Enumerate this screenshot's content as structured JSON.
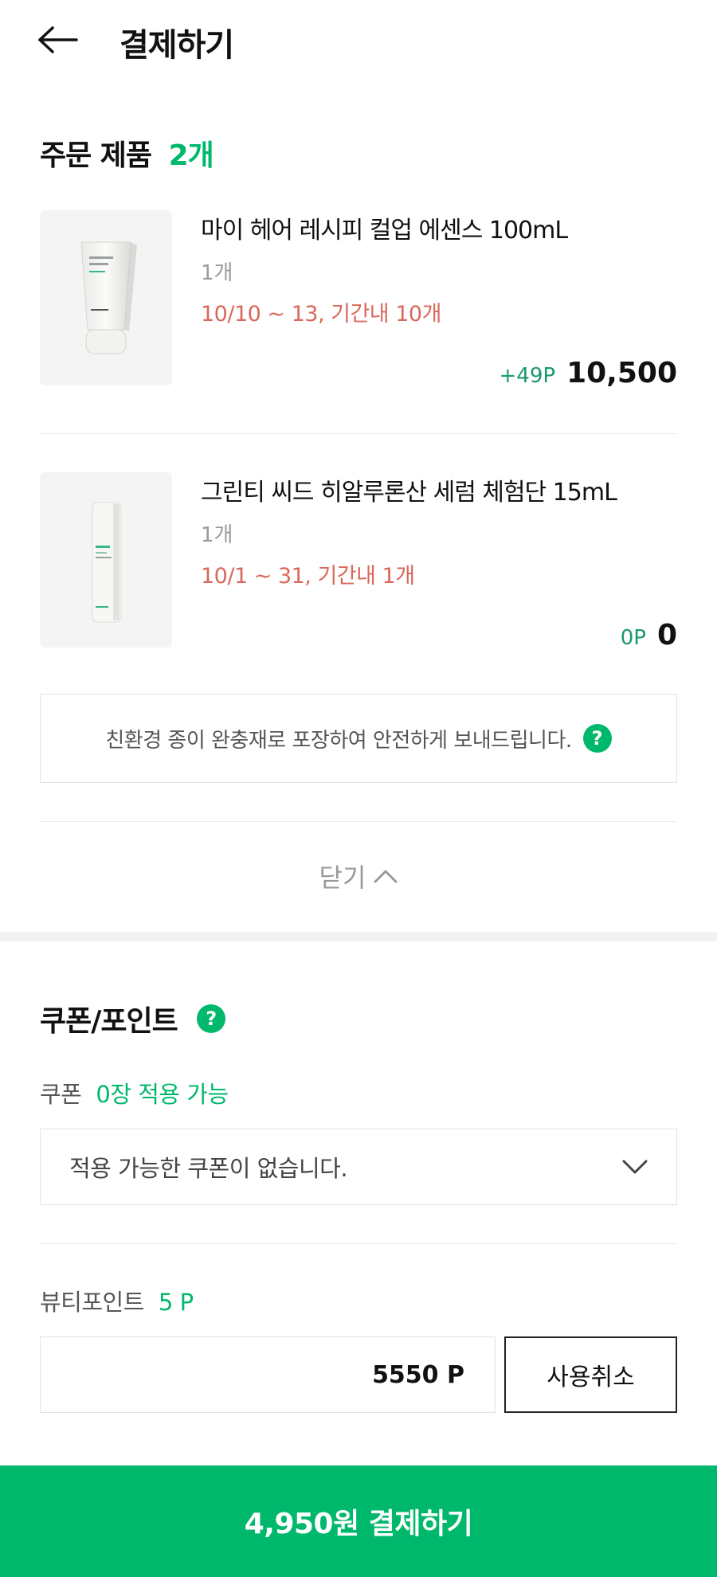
{
  "header": {
    "title": "결제하기",
    "back_icon": "arrow-left-icon"
  },
  "order": {
    "title": "주문 제품",
    "count": "2개",
    "products": [
      {
        "name": "마이 헤어 레시피 컬업 에센스 100mL",
        "qty": "1개",
        "period": "10/10 ~ 13, 기간내 10개",
        "point": "+49P",
        "price": "10,500"
      },
      {
        "name": "그린티 씨드 히알루론산 세럼 체험단 15mL",
        "qty": "1개",
        "period": "10/1 ~ 31, 기간내 1개",
        "point": "0P",
        "price": "0"
      }
    ],
    "notice": "친환경 종이 완충재로 포장하여 안전하게 보내드립니다.",
    "help_symbol": "?",
    "close_label": "닫기"
  },
  "coupon_point": {
    "title": "쿠폰/포인트",
    "help_symbol": "?",
    "coupon_label": "쿠폰",
    "coupon_available": "0장 적용 가능",
    "coupon_placeholder": "적용 가능한 쿠폰이 없습니다.",
    "point_label": "뷰티포인트",
    "point_balance": "5 P",
    "point_value": "5550 P",
    "cancel_label": "사용취소"
  },
  "pay_button": {
    "label": "4,950원 결제하기"
  },
  "colors": {
    "accent": "#00b86b",
    "period": "#d9685a",
    "point_green": "#1a9a6a"
  }
}
